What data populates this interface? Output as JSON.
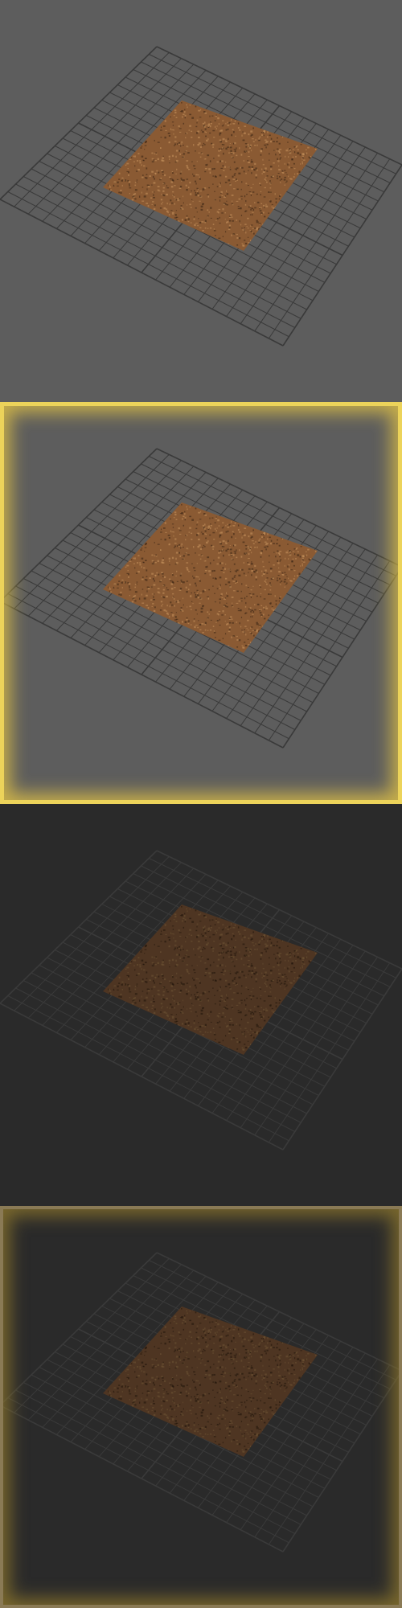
{
  "thumbnails": [
    {
      "id": "normal",
      "state": "normal",
      "background": "#5d5d5d",
      "grid_color": "#3a3a3a",
      "texture_tint": "#8a5a33",
      "texture_brightness": 1.0,
      "selected": false
    },
    {
      "id": "selected",
      "state": "selected",
      "background": "#5d5d5d",
      "grid_color": "#3a3a3a",
      "texture_tint": "#8a5a33",
      "texture_brightness": 1.0,
      "selected": true,
      "highlight": "#ecd35a"
    },
    {
      "id": "dimmed",
      "state": "dimmed",
      "background": "#2a2a2a",
      "grid_color": "#3a3a3a",
      "texture_tint": "#4e3522",
      "texture_brightness": 0.55,
      "selected": false
    },
    {
      "id": "dimmed-selected",
      "state": "dimmed-selected",
      "background": "#2a2a2a",
      "grid_color": "#3a3a3a",
      "texture_tint": "#4e3522",
      "texture_brightness": 0.55,
      "selected": true,
      "highlight": "#8a7a55"
    }
  ]
}
